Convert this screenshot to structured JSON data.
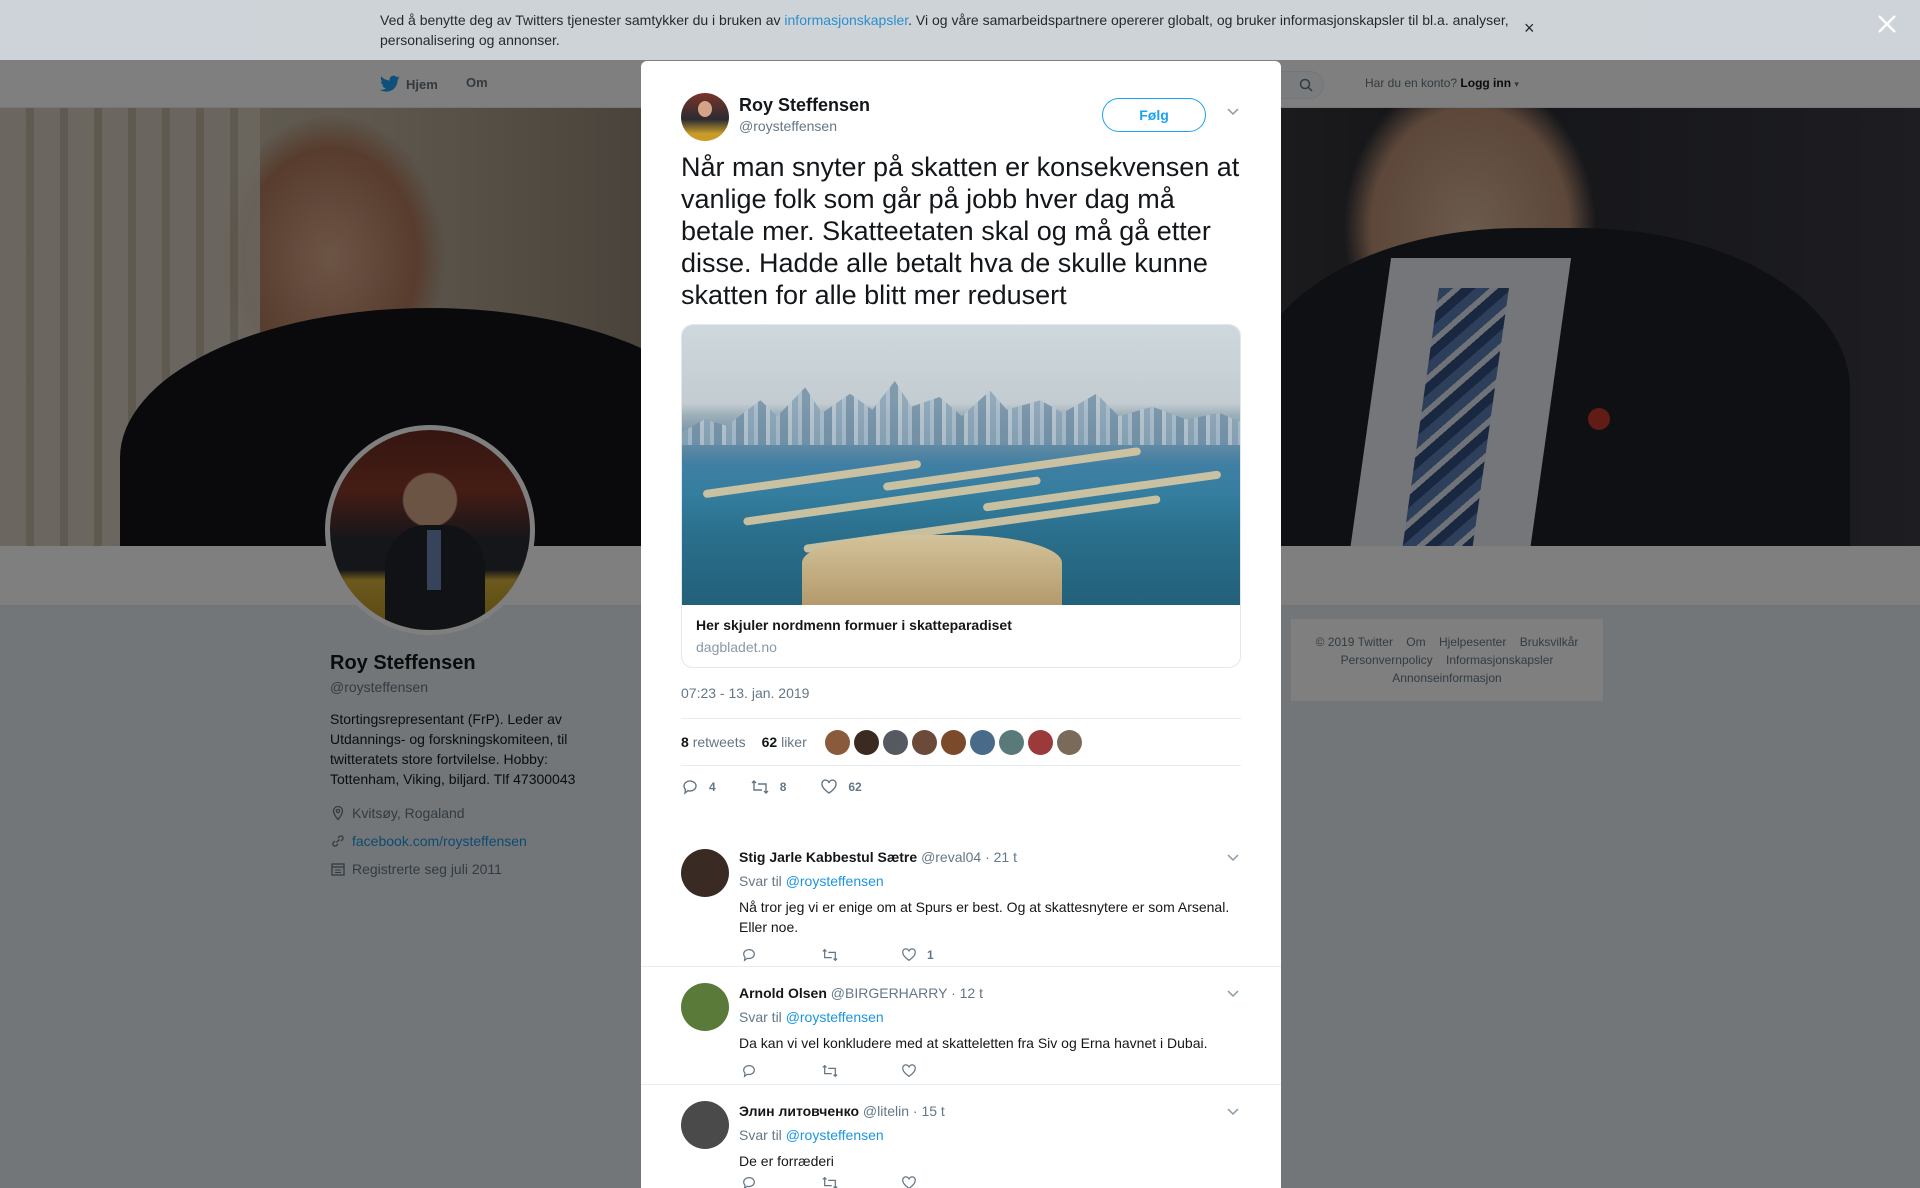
{
  "cookie_banner": {
    "text_before": "Ved å benytte deg av Twitters tjenester samtykker du i bruken av ",
    "link": "informasjonskapsler",
    "text_after": ". Vi og våre samarbeidspartnere opererer globalt, og bruker informasjonskapsler til bl.a. analyser, personalisering og annonser.",
    "close": "×"
  },
  "nav": {
    "home": "Hjem",
    "about": "Om",
    "login_prompt": "Har du en konto?",
    "login": "Logg inn"
  },
  "profile": {
    "name": "Roy Steffensen",
    "handle": "@roysteffensen",
    "bio": "Stortingsrepresentant (FrP). Leder av Utdannings- og forskningskomiteen, til twitteratets store fortvilelse. Hobby: Tottenham, Viking, biljard. Tlf 47300043",
    "location": "Kvitsøy, Rogaland",
    "website": "facebook.com/roysteffensen",
    "joined": "Registrerte seg juli 2011"
  },
  "footer": {
    "links": [
      "© 2019 Twitter",
      "Om",
      "Hjelpesenter",
      "Bruksvilkår",
      "Personvernpolicy",
      "Informasjonskapsler",
      "Annonseinformasjon"
    ]
  },
  "tweet": {
    "name": "Roy Steffensen",
    "handle": "@roysteffensen",
    "follow": "Følg",
    "text": "Når man snyter på skatten er konsekvensen at vanlige folk som går på jobb hver dag må betale mer. Skatteetaten skal og må gå etter disse. Hadde alle betalt hva de skulle kunne skatten for alle blitt mer redusert",
    "card_title": "Her skjuler nordmenn formuer i skatteparadiset",
    "card_domain": "dagbladet.no",
    "timestamp": "07:23 - 13. jan. 2019",
    "retweets_count": "8",
    "retweets_label": "retweets",
    "likes_count": "62",
    "likes_label": "liker",
    "reply_count": "4",
    "retweet_count": "8",
    "like_count": "62",
    "face_colors": [
      "#8a5a3c",
      "#3a2a22",
      "#555a60",
      "#6b4a3a",
      "#7a4a2a",
      "#4a6a8a",
      "#5a7a7a",
      "#9a3a3a",
      "#7a6a5a"
    ]
  },
  "replies": [
    {
      "name": "Stig Jarle Kabbestul Sætre",
      "handle": "@reval04",
      "time": "· 21 t",
      "reply_to_label": "Svar til",
      "reply_to": "@roysteffensen",
      "text": "Nå tror jeg vi er enige om at Spurs er best. Og at skattesnytere er som Arsenal. Eller noe.",
      "likes": "1",
      "avatar_color": "#3a2a24"
    },
    {
      "name": "Arnold Olsen",
      "handle": "@BIRGERHARRY",
      "time": "· 12 t",
      "reply_to_label": "Svar til",
      "reply_to": "@roysteffensen",
      "text": "Da kan vi vel konkludere med at skatteletten fra Siv og Erna havnet i Dubai.",
      "likes": "",
      "avatar_color": "#5a7a3a"
    },
    {
      "name": "Элин литовченко",
      "handle": "@litelin",
      "time": "· 15 t",
      "reply_to_label": "Svar til",
      "reply_to": "@roysteffensen",
      "text": "De er forræderi",
      "likes": "",
      "avatar_color": "#4a4a4a"
    }
  ]
}
